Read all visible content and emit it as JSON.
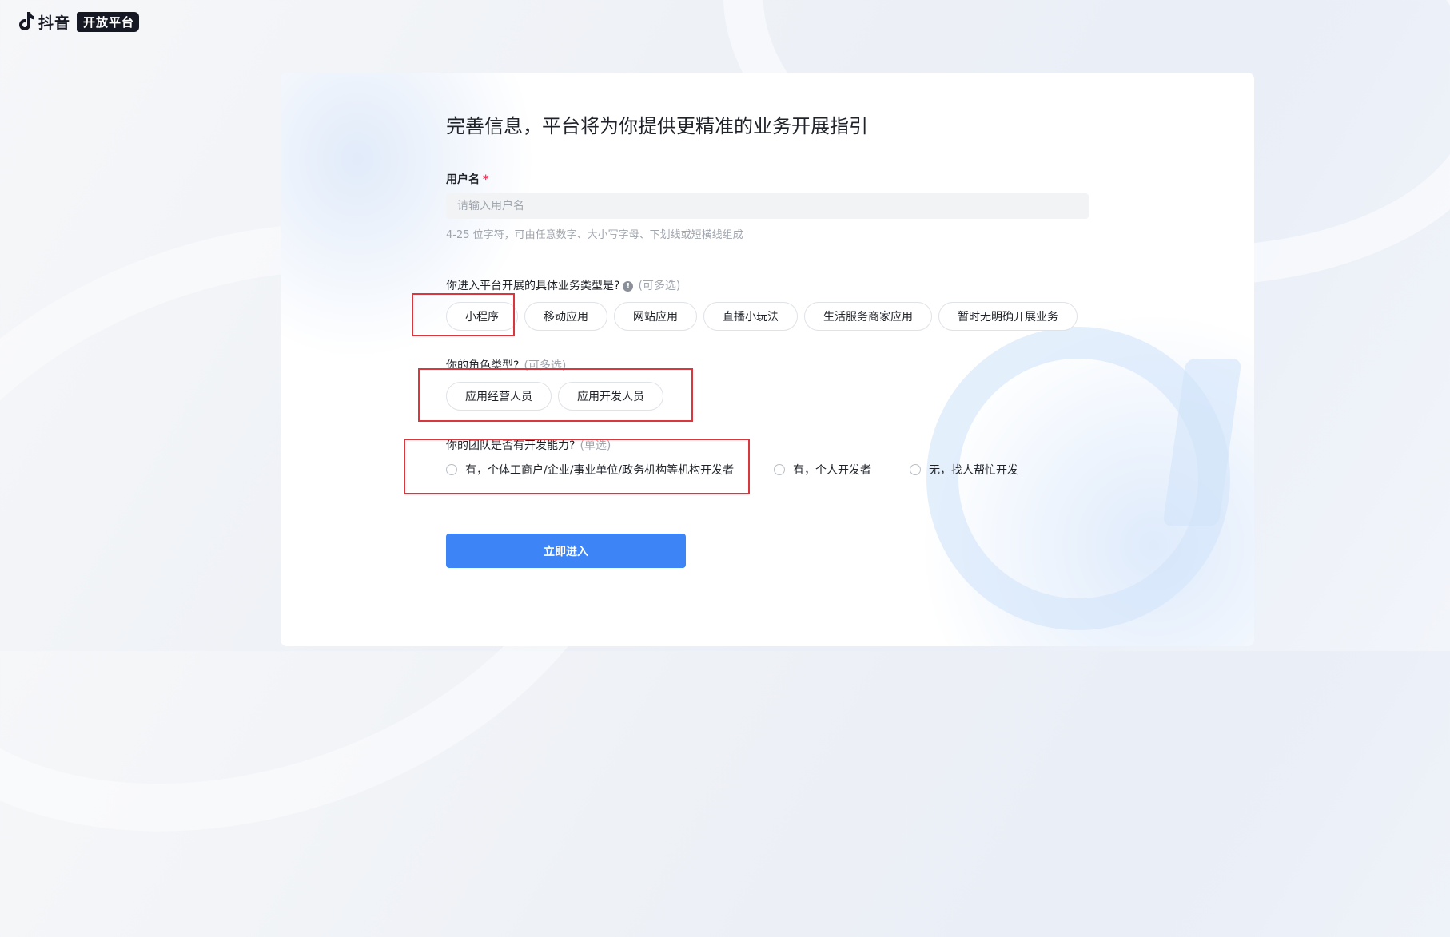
{
  "brand": {
    "name": "抖音",
    "tag": "开放平台"
  },
  "page": {
    "title": "完善信息，平台将为你提供更精准的业务开展指引"
  },
  "username": {
    "label": "用户名",
    "required_mark": "*",
    "placeholder": "请输入用户名",
    "value": "",
    "helper": "4-25 位字符，可由任意数字、大小写字母、下划线或短横线组成"
  },
  "business_type": {
    "label": "你进入平台开展的具体业务类型是?",
    "info_icon": "info-icon",
    "hint": "(可多选)",
    "options": [
      "小程序",
      "移动应用",
      "网站应用",
      "直播小玩法",
      "生活服务商家应用",
      "暂时无明确开展业务"
    ]
  },
  "role_type": {
    "label": "你的角色类型?",
    "hint": "(可多选)",
    "options": [
      "应用经营人员",
      "应用开发人员"
    ]
  },
  "dev_ability": {
    "label": "你的团队是否有开发能力?",
    "hint": "(单选)",
    "options": [
      "有，个体工商户/企业/事业单位/政务机构等机构开发者",
      "有，个人开发者",
      "无，找人帮忙开发"
    ]
  },
  "submit": {
    "label": "立即进入"
  },
  "colors": {
    "primary": "#3d85f7",
    "required": "#fe2c55",
    "highlight": "#d9363e"
  }
}
